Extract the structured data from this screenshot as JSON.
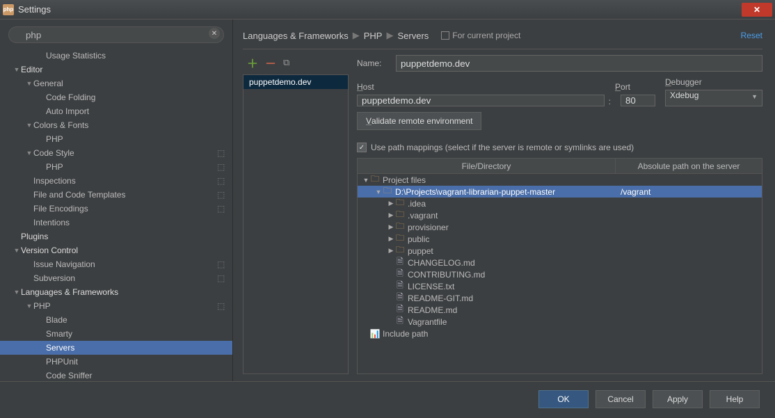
{
  "window": {
    "title": "Settings"
  },
  "search": {
    "value": "php"
  },
  "sidebar": {
    "items": [
      {
        "label": "Usage Statistics",
        "depth": 2,
        "expandable": false
      },
      {
        "label": "Editor",
        "depth": 0,
        "expandable": true,
        "expanded": true,
        "bold": true
      },
      {
        "label": "General",
        "depth": 1,
        "expandable": true,
        "expanded": true
      },
      {
        "label": "Code Folding",
        "depth": 2
      },
      {
        "label": "Auto Import",
        "depth": 2
      },
      {
        "label": "Colors & Fonts",
        "depth": 1,
        "expandable": true,
        "expanded": true
      },
      {
        "label": "PHP",
        "depth": 2
      },
      {
        "label": "Code Style",
        "depth": 1,
        "expandable": true,
        "expanded": true,
        "cfg": true
      },
      {
        "label": "PHP",
        "depth": 2,
        "cfg": true
      },
      {
        "label": "Inspections",
        "depth": 1,
        "cfg": true
      },
      {
        "label": "File and Code Templates",
        "depth": 1,
        "cfg": true
      },
      {
        "label": "File Encodings",
        "depth": 1,
        "cfg": true
      },
      {
        "label": "Intentions",
        "depth": 1
      },
      {
        "label": "Plugins",
        "depth": 0,
        "bold": true
      },
      {
        "label": "Version Control",
        "depth": 0,
        "expandable": true,
        "expanded": true,
        "bold": true
      },
      {
        "label": "Issue Navigation",
        "depth": 1,
        "cfg": true
      },
      {
        "label": "Subversion",
        "depth": 1,
        "cfg": true
      },
      {
        "label": "Languages & Frameworks",
        "depth": 0,
        "expandable": true,
        "expanded": true,
        "bold": true
      },
      {
        "label": "PHP",
        "depth": 1,
        "expandable": true,
        "expanded": true,
        "cfg": true
      },
      {
        "label": "Blade",
        "depth": 2
      },
      {
        "label": "Smarty",
        "depth": 2
      },
      {
        "label": "Servers",
        "depth": 2,
        "selected": true
      },
      {
        "label": "PHPUnit",
        "depth": 2
      },
      {
        "label": "Code Sniffer",
        "depth": 2
      }
    ]
  },
  "breadcrumb": [
    "Languages & Frameworks",
    "PHP",
    "Servers"
  ],
  "scope_label": "For current project",
  "reset_label": "Reset",
  "servers": {
    "items": [
      "puppetdemo.dev"
    ]
  },
  "form": {
    "name_label": "Name:",
    "name_value": "puppetdemo.dev",
    "host_label": "Host",
    "host_value": "puppetdemo.dev",
    "port_label": "Port",
    "port_value": "80",
    "debugger_label": "Debugger",
    "debugger_value": "Xdebug",
    "validate_label": "Validate remote environment",
    "mappings_checkbox": "Use path mappings (select if the server is remote or symlinks are used)"
  },
  "mappings": {
    "col1": "File/Directory",
    "col2": "Absolute path on the server",
    "rows": [
      {
        "depth": 0,
        "type": "folder",
        "name": "Project files",
        "expandable": true,
        "expanded": true
      },
      {
        "depth": 1,
        "type": "folder",
        "name": "D:\\Projects\\vagrant-librarian-puppet-master",
        "abspath": "/vagrant",
        "expandable": true,
        "expanded": true,
        "hl": true
      },
      {
        "depth": 2,
        "type": "folder",
        "name": ".idea",
        "expandable": true
      },
      {
        "depth": 2,
        "type": "folder",
        "name": ".vagrant",
        "expandable": true
      },
      {
        "depth": 2,
        "type": "folder",
        "name": "provisioner",
        "expandable": true
      },
      {
        "depth": 2,
        "type": "folder",
        "name": "public",
        "expandable": true
      },
      {
        "depth": 2,
        "type": "folder",
        "name": "puppet",
        "expandable": true
      },
      {
        "depth": 2,
        "type": "file",
        "name": "CHANGELOG.md"
      },
      {
        "depth": 2,
        "type": "file",
        "name": "CONTRIBUTING.md"
      },
      {
        "depth": 2,
        "type": "file",
        "name": "LICENSE.txt"
      },
      {
        "depth": 2,
        "type": "file",
        "name": "README-GIT.md"
      },
      {
        "depth": 2,
        "type": "file",
        "name": "README.md"
      },
      {
        "depth": 2,
        "type": "file",
        "name": "Vagrantfile"
      },
      {
        "depth": 0,
        "type": "include",
        "name": "Include path"
      }
    ]
  },
  "footer": {
    "ok": "OK",
    "cancel": "Cancel",
    "apply": "Apply",
    "help": "Help"
  }
}
